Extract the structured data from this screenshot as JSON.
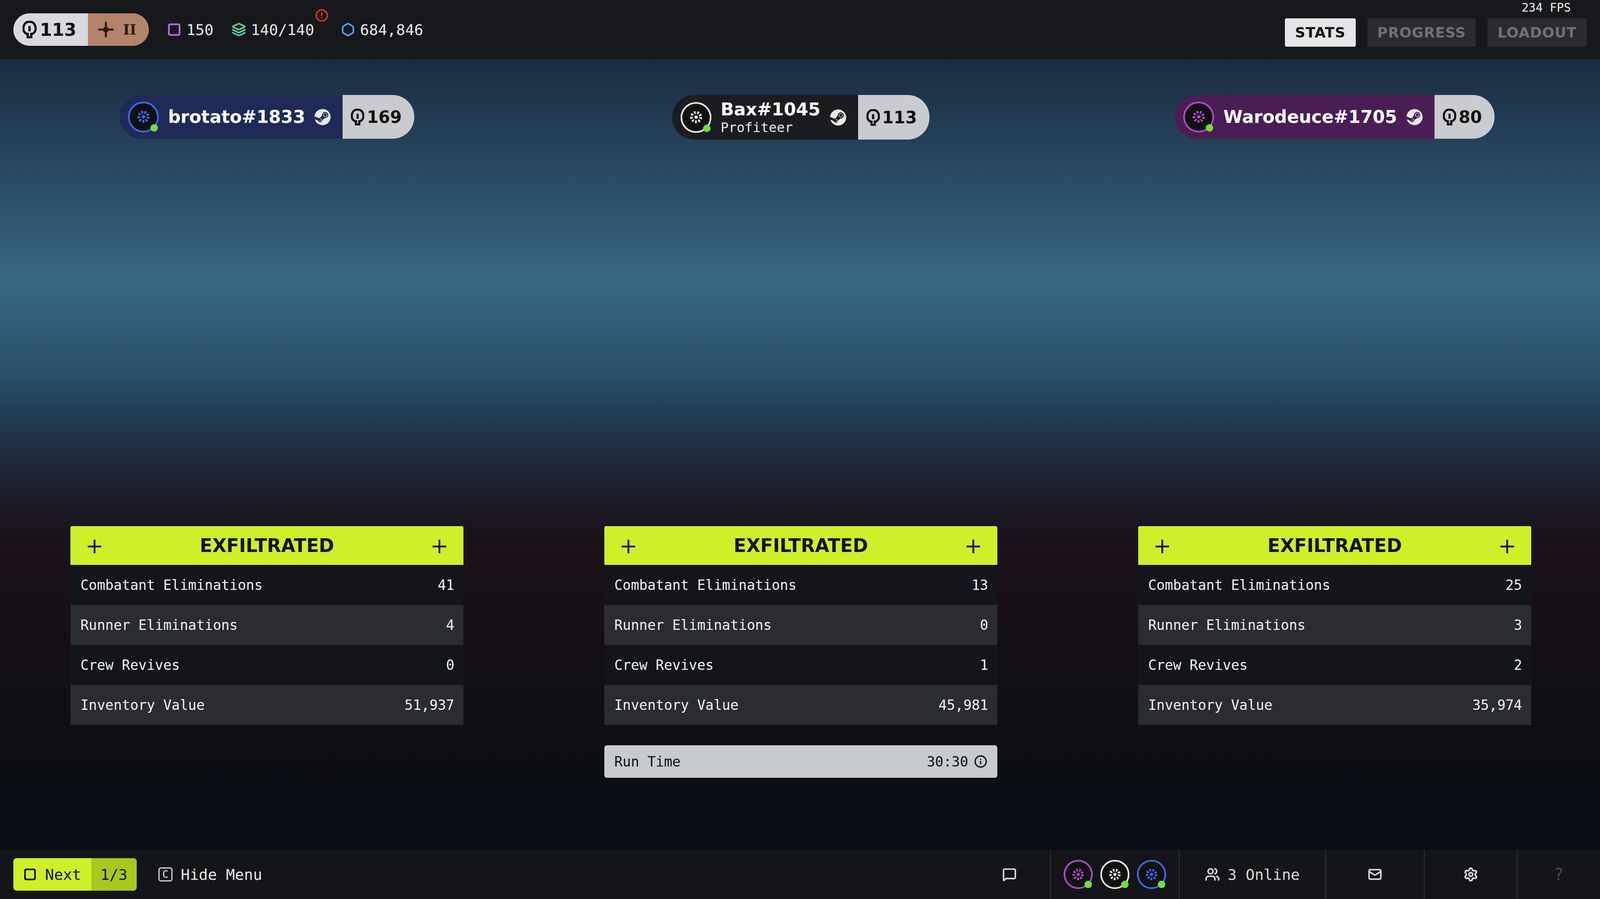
{
  "topbar": {
    "level": "113",
    "rank": "II",
    "keys": "150",
    "capacity": "140/140",
    "capacity_alert": true,
    "credits": "684,846"
  },
  "tabs": [
    {
      "label": "STATS",
      "selected": true
    },
    {
      "label": "PROGRESS",
      "selected": false
    },
    {
      "label": "LOADOUT",
      "selected": false
    }
  ],
  "fps": "234 FPS",
  "players": [
    {
      "name": "brotato#1833",
      "level": "169",
      "color": "#1f2a57",
      "accent": "#3a6cff",
      "online": true,
      "marker": "+",
      "status": "EXFILTRATED",
      "stats": [
        {
          "label": "Combatant Eliminations",
          "value": "41"
        },
        {
          "label": "Runner Eliminations",
          "value": "4"
        },
        {
          "label": "Crew Revives",
          "value": "0"
        },
        {
          "label": "Inventory Value",
          "value": "51,937"
        }
      ]
    },
    {
      "name": "Bax#1045",
      "title": "Profiteer",
      "level": "113",
      "color": "#1b1c1f",
      "accent": "#e8e8e8",
      "online": true,
      "marker": "+",
      "status": "EXFILTRATED",
      "stats": [
        {
          "label": "Combatant Eliminations",
          "value": "13"
        },
        {
          "label": "Runner Eliminations",
          "value": "0"
        },
        {
          "label": "Crew Revives",
          "value": "1"
        },
        {
          "label": "Inventory Value",
          "value": "45,981"
        }
      ],
      "run_time": {
        "label": "Run Time",
        "value": "30:30"
      }
    },
    {
      "name": "Warodeuce#1705",
      "level": "80",
      "color": "#4a1d55",
      "accent": "#b04ad0",
      "online": true,
      "marker": "+",
      "status": "EXFILTRATED",
      "stats": [
        {
          "label": "Combatant Eliminations",
          "value": "25"
        },
        {
          "label": "Runner Eliminations",
          "value": "3"
        },
        {
          "label": "Crew Revives",
          "value": "2"
        },
        {
          "label": "Inventory Value",
          "value": "35,974"
        }
      ]
    }
  ],
  "bottombar": {
    "next": {
      "label": "Next",
      "page": "1/3"
    },
    "hide": {
      "key": "C",
      "label": "Hide Menu"
    },
    "online": "3 Online",
    "help": "?"
  }
}
